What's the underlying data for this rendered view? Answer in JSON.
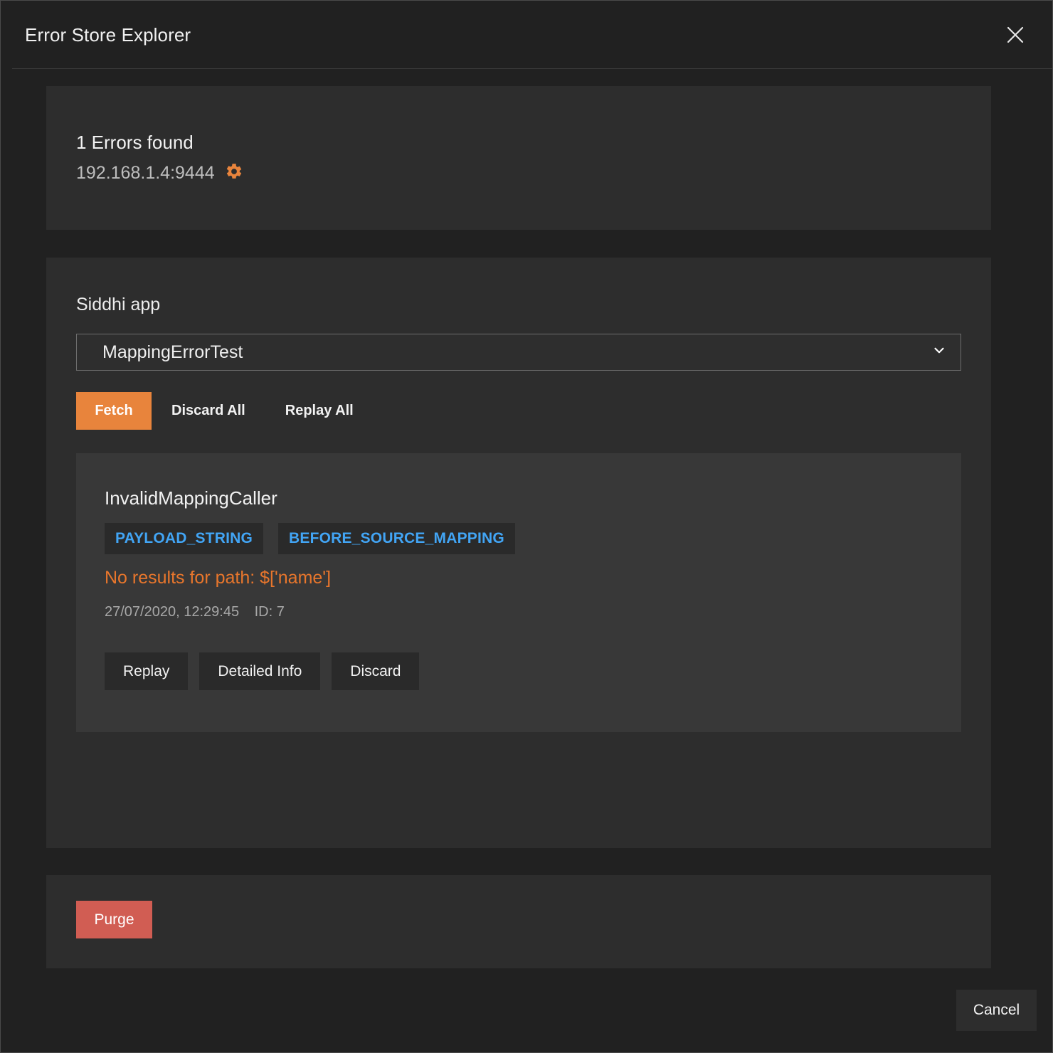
{
  "header": {
    "title": "Error Store Explorer",
    "close_icon": "close-icon"
  },
  "summary": {
    "errors_found": "1 Errors found",
    "host": "192.168.1.4:9444",
    "settings_icon": "gear-icon",
    "accent_color": "#e8843c"
  },
  "main": {
    "field_label": "Siddhi app",
    "selected_app": "MappingErrorTest",
    "app_options": [
      "MappingErrorTest"
    ],
    "dropdown_icon": "chevron-down-icon",
    "actions": {
      "fetch": "Fetch",
      "discard_all": "Discard All",
      "replay_all": "Replay All"
    }
  },
  "error_card": {
    "name": "InvalidMappingCaller",
    "chips": [
      "PAYLOAD_STRING",
      "BEFORE_SOURCE_MAPPING"
    ],
    "message": "No results for path: $['name']",
    "timestamp": "27/07/2020, 12:29:45",
    "id_label": "ID: 7",
    "actions": {
      "replay": "Replay",
      "detailed_info": "Detailed Info",
      "discard": "Discard"
    },
    "chip_color": "#42a5f5",
    "message_color": "#e8762c"
  },
  "purge": {
    "label": "Purge",
    "color": "#d15d53"
  },
  "footer": {
    "cancel": "Cancel"
  }
}
